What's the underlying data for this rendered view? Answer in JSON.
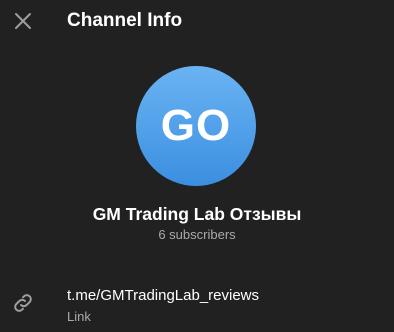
{
  "header": {
    "title": "Channel Info",
    "close_icon": "close-icon"
  },
  "channel": {
    "avatar_initials": "GO",
    "avatar_color_top": "#6ab3f3",
    "avatar_color_bottom": "#3b8fe0",
    "name": "GM Trading Lab Отзывы",
    "subscribers": "6 subscribers"
  },
  "info": {
    "link_icon": "link-icon",
    "link_value": "t.me/GMTradingLab_reviews",
    "link_caption": "Link"
  },
  "colors": {
    "background": "#212121",
    "primary_text": "#ffffff",
    "secondary_text": "#aaaaaa",
    "icon": "#9e9e9e"
  }
}
